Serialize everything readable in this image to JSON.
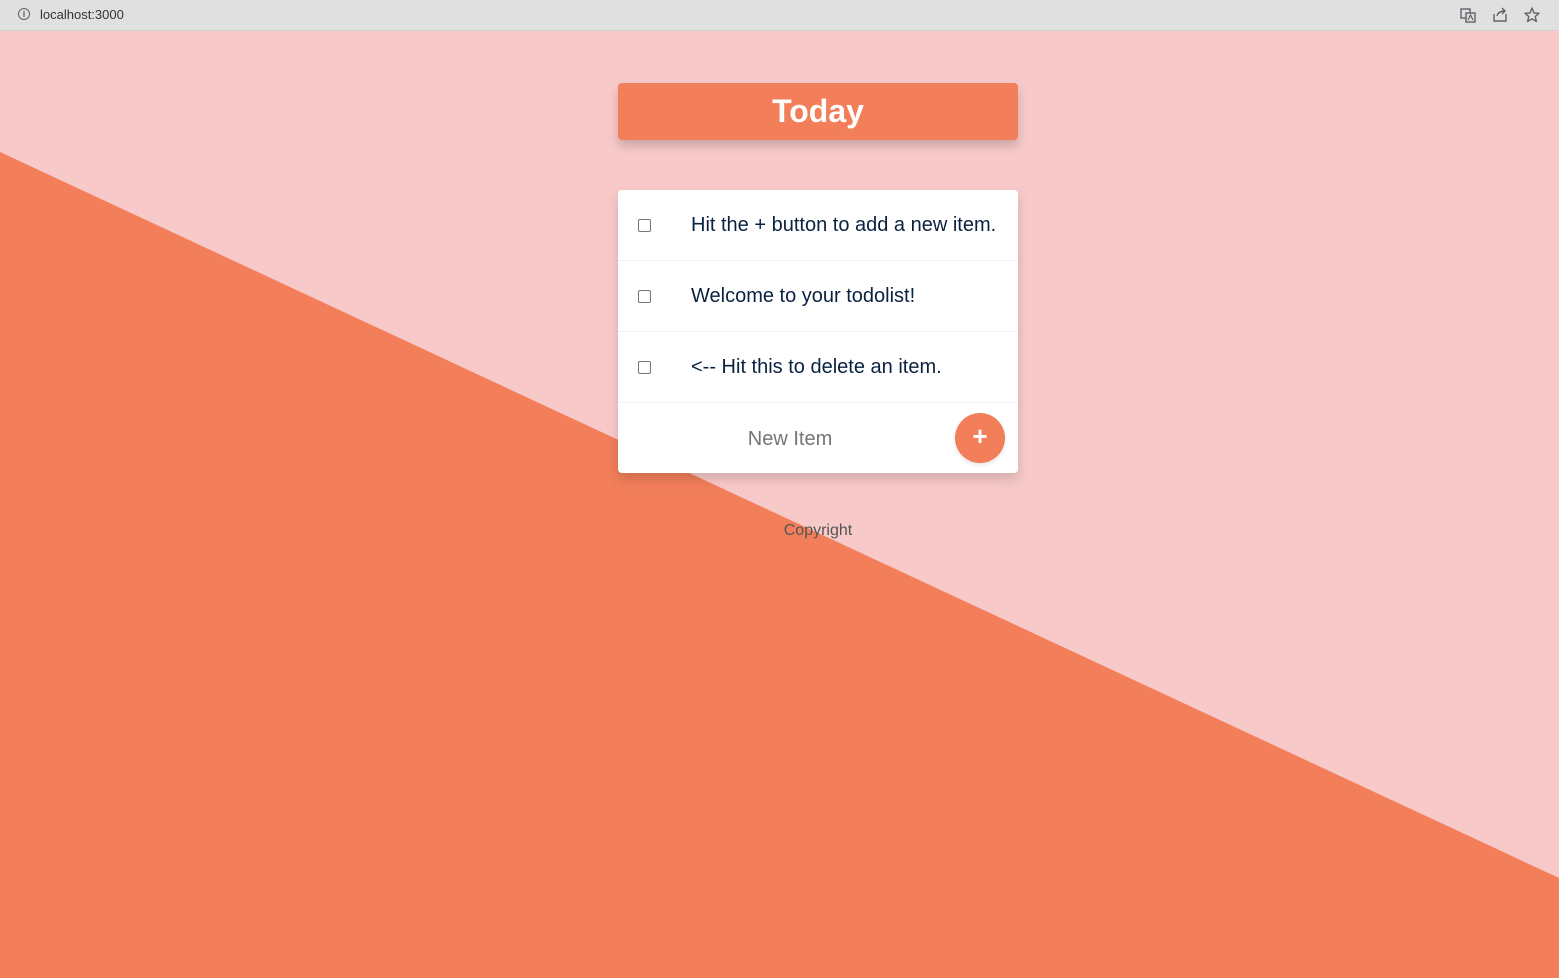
{
  "browser": {
    "url": "localhost:3000",
    "info_symbol": "i"
  },
  "colors": {
    "accent": "#f27e5a",
    "background_light": "#f8c9c9",
    "text_dark": "#0a2140"
  },
  "list": {
    "title": "Today",
    "items": [
      {
        "label": "Hit the + button to add a new item.",
        "checked": false
      },
      {
        "label": "Welcome to your todolist!",
        "checked": false
      },
      {
        "label": "<-- Hit this to delete an item.",
        "checked": false
      }
    ],
    "new_item_placeholder": "New Item",
    "add_button_label": "+"
  },
  "footer": {
    "text": "Copyright"
  }
}
